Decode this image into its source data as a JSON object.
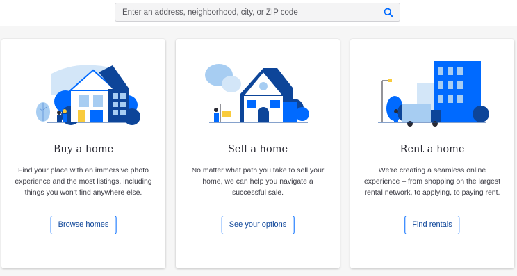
{
  "search": {
    "placeholder": "Enter an address, neighborhood, city, or ZIP code",
    "icon": "search-icon"
  },
  "colors": {
    "accent": "#006aff",
    "dark_blue": "#0d4599",
    "light_blue": "#a7cdf2",
    "yellow": "#f9cb3c"
  },
  "cards": [
    {
      "title": "Buy a home",
      "description": "Find your place with an immersive photo experience and the most listings, including things you won’t find anywhere else.",
      "button": "Browse homes",
      "illustration": "house-with-people-illustration"
    },
    {
      "title": "Sell a home",
      "description": "No matter what path you take to sell your home, we can help you navigate a successful sale.",
      "button": "See your options",
      "illustration": "house-with-sign-illustration"
    },
    {
      "title": "Rent a home",
      "description": "We’re creating a seamless online experience – from shopping on the largest rental network, to applying, to paying rent.",
      "button": "Find rentals",
      "illustration": "apartment-with-truck-illustration"
    }
  ]
}
